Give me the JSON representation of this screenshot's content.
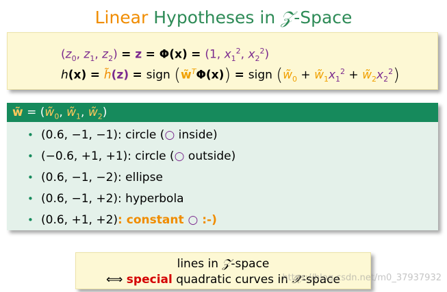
{
  "title": {
    "word_linear": "Linear",
    "word_hypotheses": "Hypotheses in",
    "z_symbol": "𝒵",
    "word_space": "-Space"
  },
  "formula": {
    "line1": {
      "lhs_open": "(",
      "z": "z",
      "sub0": "0",
      "sub1": "1",
      "sub2": "2",
      "comma": ", ",
      "lhs_close": ")",
      "eq": " = ",
      "z_bold": "z",
      "phi": "Φ",
      "x_arg": "(x)",
      "rhs_open": "(1, ",
      "x": "x",
      "sq": "2",
      "rhs_close": ")"
    },
    "line2": {
      "h": "h",
      "x_arg": "(x)",
      "eq": " = ",
      "h_tilde": "h̃",
      "z_arg": "(z)",
      "sign": "sign",
      "lparen": "(",
      "rparen": ")",
      "w_tilde_bold": "w̃",
      "transpose": "T",
      "phi": "Φ",
      "w_tilde": "w̃",
      "plus": " + ",
      "x": "x"
    }
  },
  "panel": {
    "header": {
      "w_bold": "w̃",
      "eq": " = (",
      "w0": "w̃",
      "w1": "w̃",
      "w2": "w̃",
      "comma": ", ",
      "close": ")"
    },
    "bullet_char": "•",
    "items": [
      {
        "vec": "(0.6, −1, −1)",
        "desc": ": circle (",
        "mark": "○",
        "tail": " inside)"
      },
      {
        "vec": "(−0.6, +1, +1)",
        "desc": ": circle (",
        "mark": "○",
        "tail": " outside)"
      },
      {
        "vec": "(0.6, −1, −2)",
        "desc": ": ellipse",
        "mark": "",
        "tail": ""
      },
      {
        "vec": "(0.6, −1, +2)",
        "desc": ": hyperbola",
        "mark": "",
        "tail": ""
      },
      {
        "vec": "(0.6, +1, +2)",
        "desc": ": constant ",
        "mark": "○",
        "tail": " :-)"
      }
    ]
  },
  "note": {
    "line1_pre": "lines in ",
    "z_symbol": "𝒵",
    "line1_post": "-space",
    "iff": "⟺",
    "special": "special",
    "line2_mid": " quadratic curves in ",
    "x_symbol": "𝒳",
    "line2_post": "-space"
  },
  "watermark": "https://blog.csdn.net/m0_37937932",
  "colors": {
    "accent_orange": "#f08c00",
    "title_green": "#2e8b57",
    "panel_header": "#168a5c",
    "panel_bg": "#e4f1ea",
    "note_bg": "#fdf8d4",
    "purple": "#7b2a8e",
    "red": "#d40000"
  }
}
